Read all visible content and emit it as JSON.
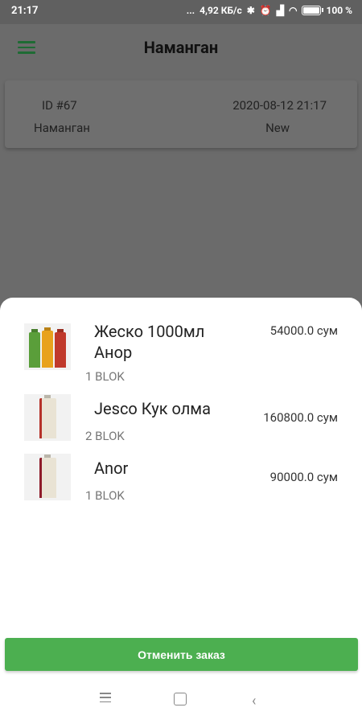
{
  "status_bar": {
    "time": "21:17",
    "dots": "...",
    "speed": "4,92 КБ/с",
    "battery": "100 %"
  },
  "appbar": {
    "title": "Наманган"
  },
  "order": {
    "id": "ID #67",
    "date": "2020-08-12 21:17",
    "city": "Наманган",
    "status": "New"
  },
  "items": [
    {
      "name_line1": "Жеско 1000мл",
      "name_line2": "Анор",
      "price": "54000.0 сум",
      "qty": "1 BLOK"
    },
    {
      "name_line1": "Jesco Кук олма",
      "price": "160800.0 сум",
      "qty": "2 BLOK"
    },
    {
      "name_line1": "Anor",
      "price": "90000.0 сум",
      "qty": "1 BLOK"
    }
  ],
  "cancel_button": "Отменить заказ",
  "colors": {
    "accent": "#4caf50",
    "menu_icon": "#1e6b34",
    "scrim": "#6b6b6b"
  }
}
